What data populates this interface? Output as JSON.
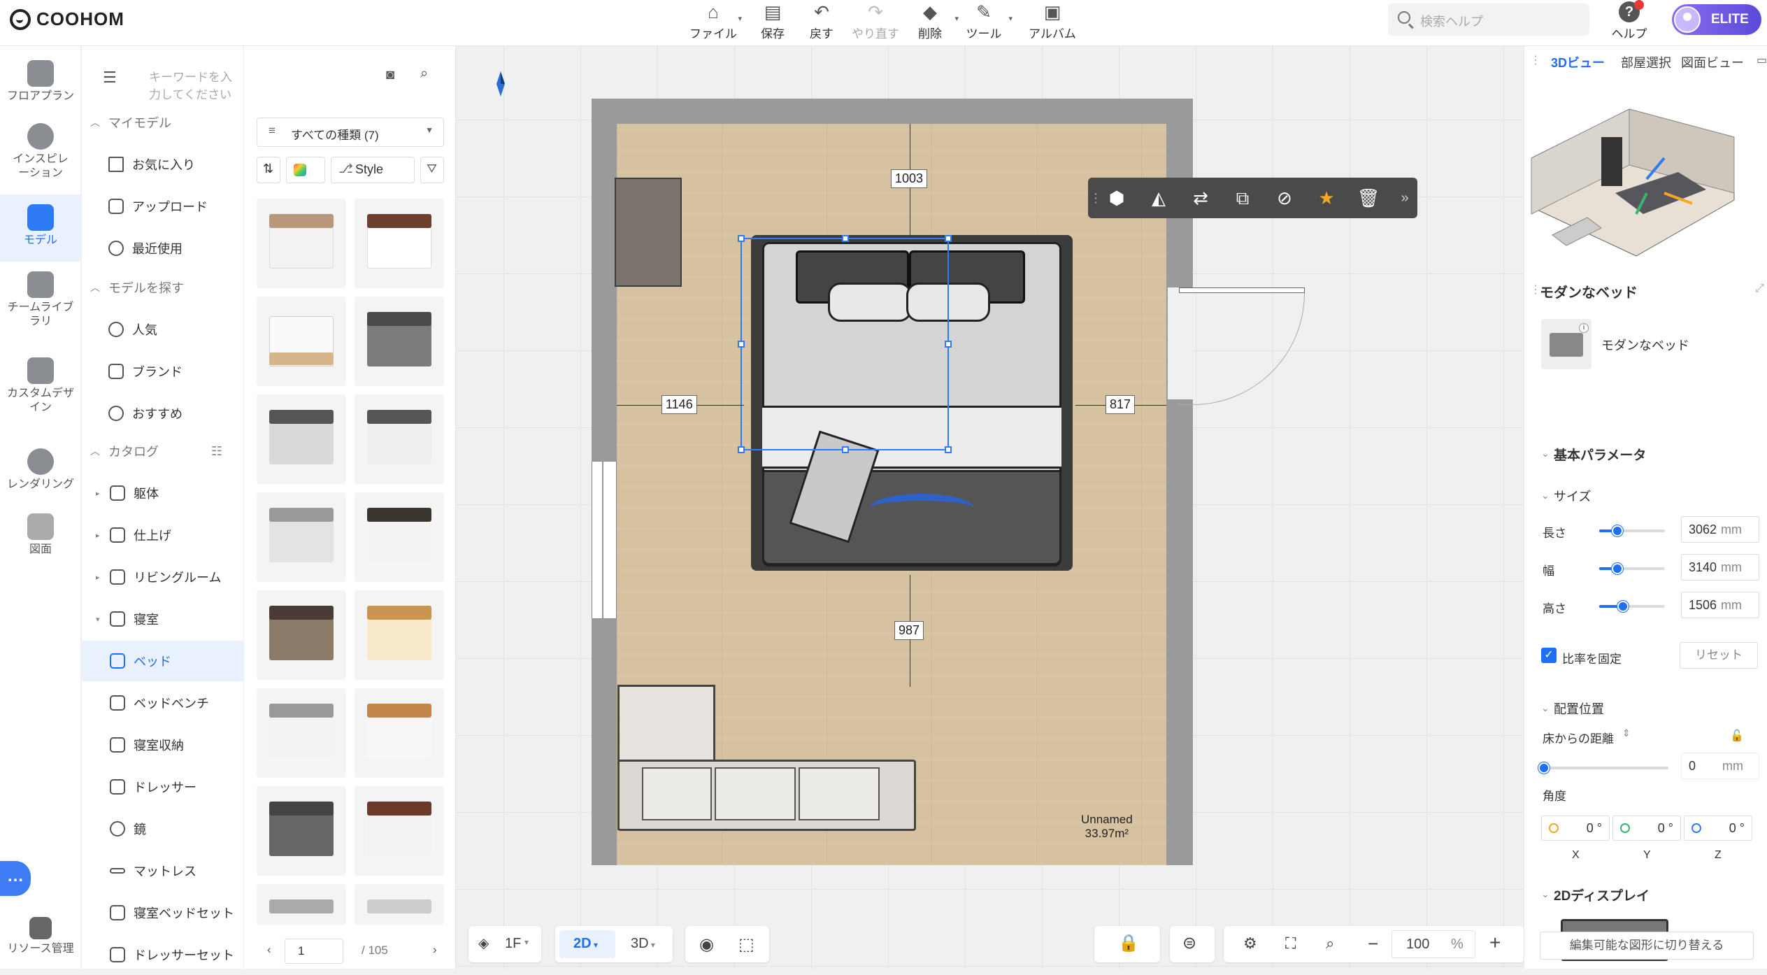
{
  "app": {
    "brand": "COOHOM"
  },
  "toolbar": {
    "file": "ファイル",
    "save": "保存",
    "undo": "戻す",
    "redo": "やり直す",
    "delete": "削除",
    "tools": "ツール",
    "album": "アルバム"
  },
  "header": {
    "search_placeholder": "検索ヘルプ",
    "help": "ヘルプ",
    "plan": "ELITE"
  },
  "leftnav": {
    "items": [
      {
        "label": "フロアプラン"
      },
      {
        "label": "インスピレーション"
      },
      {
        "label": "モデル"
      },
      {
        "label": "チームライブラリ"
      },
      {
        "label": "カスタムデザイン"
      },
      {
        "label": "レンダリング"
      },
      {
        "label": "図面"
      },
      {
        "label": "リソース管理"
      }
    ]
  },
  "catalog": {
    "search_placeholder": "キーワードを入力してください",
    "my_models": "マイモデル",
    "favorites": "お気に入り",
    "upload": "アップロード",
    "recent": "最近使用",
    "find_models": "モデルを探す",
    "popular": "人気",
    "brand": "ブランド",
    "recommended": "おすすめ",
    "catalog_head": "カタログ",
    "categories": [
      "躯体",
      "仕上げ",
      "リビングルーム",
      "寝室"
    ],
    "bedroom_items": [
      "ベッド",
      "ベッドベンチ",
      "寝室収納",
      "ドレッサー",
      "鏡",
      "マットレス",
      "寝室ベッドセット",
      "ドレッサーセット"
    ]
  },
  "grid": {
    "type_select": "すべての種類 (7)",
    "style": "Style",
    "page_current": "1",
    "page_total": "/ 105"
  },
  "canvas": {
    "dim_top": "1003",
    "dim_left": "1146",
    "dim_right": "817",
    "dim_bottom": "987",
    "room_name": "Unnamed",
    "room_area": "33.97m²",
    "floor": "1F",
    "view_2d": "2D",
    "view_3d": "3D",
    "zoom": "100",
    "zoom_unit": "%"
  },
  "right": {
    "tabs": [
      "3Dビュー",
      "部屋選択",
      "図面ビュー"
    ],
    "object_title": "モダンなベッド",
    "object_name": "モダンなベッド",
    "basic_params": "基本パラメータ",
    "size": "サイズ",
    "length_label": "長さ",
    "width_label": "幅",
    "height_label": "高さ",
    "length_value": "3062",
    "width_value": "3140",
    "height_value": "1506",
    "unit": "mm",
    "lock_ratio": "比率を固定",
    "reset": "リセット",
    "placement": "配置位置",
    "floor_distance": "床からの距離",
    "floor_distance_value": "0",
    "angle": "角度",
    "angle_x": "0 °",
    "angle_y": "0 °",
    "angle_z": "0 °",
    "axis_x": "X",
    "axis_y": "Y",
    "axis_z": "Z",
    "display_2d": "2Dディスプレイ",
    "switch_editable": "編集可能な図形に切り替える"
  },
  "colors": {
    "accent": "#1f6ff3",
    "elite_start": "#8b6cf0",
    "elite_end": "#5b4bd8",
    "star": "#f5a623"
  }
}
